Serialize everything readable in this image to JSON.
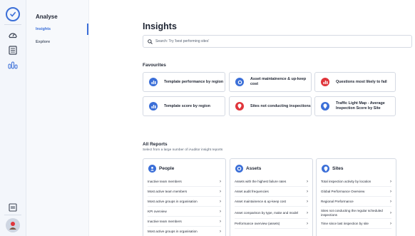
{
  "nav": {
    "title": "Analyse",
    "items": [
      {
        "label": "Insights",
        "active": true
      },
      {
        "label": "Explore",
        "active": false
      }
    ]
  },
  "page": {
    "title": "Insights",
    "search_placeholder": "Search: Try 'best performing sites'"
  },
  "favourites": {
    "title": "Favourites",
    "items": [
      {
        "label": "Template performance by region",
        "icon": "bar-chart-icon",
        "color": "#3b6fd8"
      },
      {
        "label": "Asset maintainence & up-keep cost",
        "icon": "target-icon",
        "color": "#3b6fd8"
      },
      {
        "label": "Questions most likely to fail",
        "icon": "bar-chart-icon",
        "color": "#e0353b"
      },
      {
        "label": "Template score by region",
        "icon": "bar-chart-icon",
        "color": "#3b6fd8"
      },
      {
        "label": "Sites not conducting inspections",
        "icon": "location-pin-icon",
        "color": "#e0353b"
      },
      {
        "label": "Traffic Light Map - Average Inspection Score by Site",
        "icon": "location-pin-icon",
        "color": "#3b6fd8"
      }
    ]
  },
  "reports": {
    "title": "All Reports",
    "subtitle": "Select from a large number of iAuditor insight reports",
    "cards": [
      {
        "title": "People",
        "icon": "person-icon",
        "rows": [
          "Inactive team members",
          "Most active team members",
          "Most active groups in organisation",
          "KPI overview",
          "Inactive team members",
          "Most active groups in organisation"
        ]
      },
      {
        "title": "Assets",
        "icon": "target-icon",
        "rows": [
          "Assets with the highest failure rates",
          "Asset audit frequencies",
          "Asset maintainence & up-keep cost",
          "Asset comparison by type, make and model",
          "Performance overview (assets)"
        ]
      },
      {
        "title": "Sites",
        "icon": "location-pin-icon",
        "rows": [
          "Total inspection activity by location",
          "Global Performance Overview",
          "Regional Preformance",
          "Sites not conducting the regular scheduled inspections",
          "Time since last inspection by site"
        ]
      }
    ]
  },
  "colors": {
    "accent": "#3b6fd8",
    "danger": "#e0353b"
  }
}
